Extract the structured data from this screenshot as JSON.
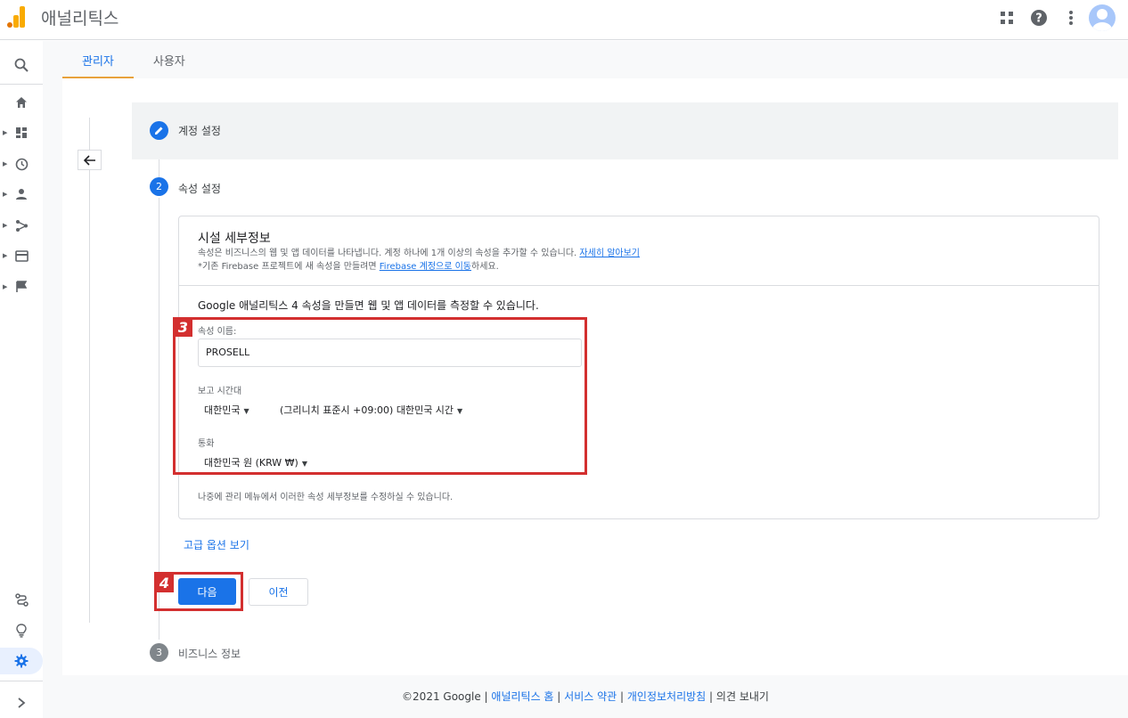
{
  "app": {
    "title": "애널리틱스"
  },
  "colors": {
    "accent": "#1a73e8",
    "highlight": "#d32f2f",
    "logo_orange": "#f9ab00",
    "logo_dark": "#e37400"
  },
  "header_icons": [
    "apps-grid-icon",
    "help-icon",
    "more-vert-icon",
    "account-avatar-icon"
  ],
  "rail_icons": [
    "search-icon",
    "home-icon",
    "dashboard-icon",
    "clock-icon",
    "person-icon",
    "flow-icon",
    "display-icon",
    "flag-icon",
    "route-icon",
    "lightbulb-icon",
    "gear-icon",
    "expand-icon"
  ],
  "tabs": [
    {
      "label": "관리자",
      "active": true
    },
    {
      "label": "사용자",
      "active": false
    }
  ],
  "steps": {
    "step1": {
      "label": "계정 설정",
      "state": "edit"
    },
    "step2": {
      "number": "2",
      "label": "속성 설정"
    },
    "step3": {
      "number": "3",
      "label": "비즈니스 정보"
    }
  },
  "card": {
    "title": "시설 세부정보",
    "desc1": "속성은 비즈니스의 웹 및 앱 데이터를 나타냅니다. 계정 하나에 1개 이상의 속성을 추가할 수 있습니다.",
    "desc1_link": "자세히 알아보기",
    "desc2_prefix": "*기존 Firebase 프로젝트에 새 속성을 만들려면",
    "desc2_link": "Firebase 계정으로 이동",
    "desc2_suffix": "하세요.",
    "lead": "Google 애널리틱스 4 속성을 만들면 웹 및 앱 데이터를 측정할 수 있습니다.",
    "property_name_label": "속성 이름:",
    "property_name_value": "PROSELL",
    "timezone_label": "보고 시간대",
    "timezone_country": "대한민국",
    "timezone_value": "(그리니치 표준시 +09:00) 대한민국 시간",
    "currency_label": "통화",
    "currency_value": "대한민국 원 (KRW ₩)",
    "footnote": "나중에 관리 메뉴에서 이러한 속성 세부정보를 수정하실 수 있습니다."
  },
  "annotations": {
    "badge3": "3",
    "badge4": "4"
  },
  "advanced_link": "고급 옵션 보기",
  "buttons": {
    "next": "다음",
    "prev": "이전"
  },
  "footer": {
    "copyright": "©2021 Google |",
    "link_home": "애널리틱스 홈",
    "sep1": "|",
    "link_terms": "서비스 약관",
    "sep2": "|",
    "link_privacy": "개인정보처리방침",
    "sep3": "|",
    "feedback": "의견 보내기"
  }
}
